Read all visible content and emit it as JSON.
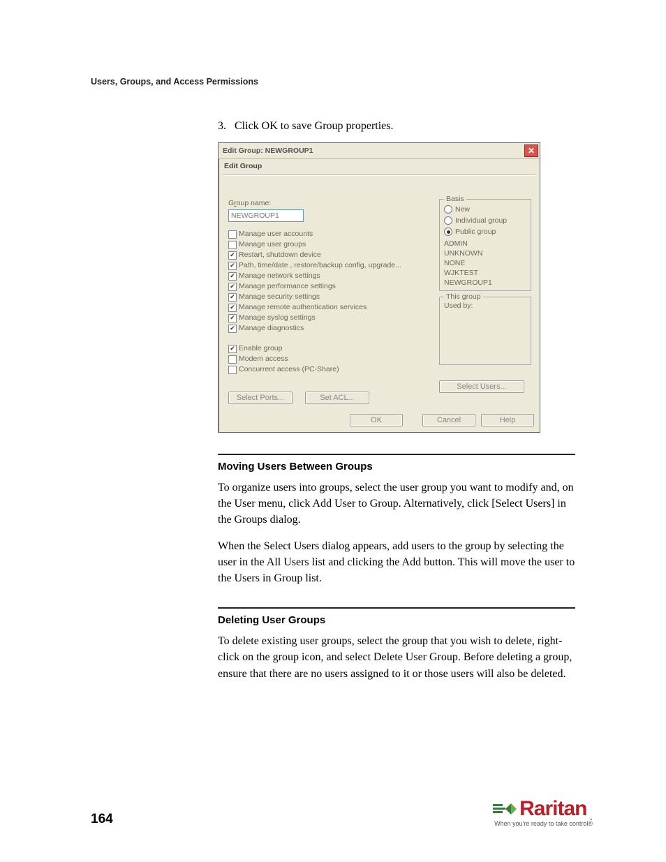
{
  "running_head": "Users, Groups, and Access Permissions",
  "step": {
    "num": "3.",
    "text": "Click OK to save Group properties."
  },
  "dialog": {
    "title": "Edit Group: NEWGROUP1",
    "close_glyph": "✕",
    "subtitle": "Edit Group",
    "group_name_label_pre": "G",
    "group_name_label_u": "r",
    "group_name_label_post": "oup name:",
    "group_name_value": "NEWGROUP1",
    "perms": [
      {
        "checked": false,
        "label": "Manage user accounts"
      },
      {
        "checked": false,
        "label": "Manage user groups"
      },
      {
        "checked": true,
        "label": "Restart, shutdown device"
      },
      {
        "checked": true,
        "label": "Path, time/date , restore/backup config, upgrade..."
      },
      {
        "checked": true,
        "label": "Manage network settings"
      },
      {
        "checked": true,
        "label": "Manage performance settings"
      },
      {
        "checked": true,
        "label": "Manage security settings"
      },
      {
        "checked": true,
        "label": "Manage remote authentication services"
      },
      {
        "checked": true,
        "label": "Manage syslog settings"
      },
      {
        "checked": true,
        "label": "Manage diagnostics"
      }
    ],
    "perms2": [
      {
        "checked": true,
        "label_pre": "",
        "label_u": "E",
        "label_post": "nable group"
      },
      {
        "checked": false,
        "label_pre": "Modem ",
        "label_u": "a",
        "label_post": "ccess"
      },
      {
        "checked": false,
        "label_pre": "Concurrent access (PC-",
        "label_u": "S",
        "label_post": "hare)"
      }
    ],
    "basis": {
      "legend": "Basis",
      "options": [
        {
          "sel": false,
          "pre": "",
          "u": "N",
          "post": "ew"
        },
        {
          "sel": false,
          "pre": "",
          "u": "I",
          "post": "ndividual group"
        },
        {
          "sel": true,
          "pre": "P",
          "u": "u",
          "post": "blic group"
        }
      ],
      "groups": [
        "ADMIN",
        "UNKNOWN",
        "NONE",
        "WJKTEST",
        "NEWGROUP1"
      ]
    },
    "this_group": {
      "legend": "This group",
      "used_by": "Used by:"
    },
    "btn_select_ports": "Select Ports...",
    "btn_set_acl": "Set ACL...",
    "btn_select_users": "Select Users...",
    "btn_ok": "OK",
    "btn_cancel": "Cancel",
    "btn_help": "Help"
  },
  "sections": {
    "moving_head": "Moving Users Between Groups",
    "moving_p1": "To organize users into groups, select the user group you want to modify and, on the User menu, click Add User to Group. Alternatively, click [Select Users] in the Groups dialog.",
    "moving_p2": "When the Select Users dialog appears, add users to the group by selecting the user in the All Users list and clicking the Add button. This will move the user to the Users in Group list.",
    "deleting_head": "Deleting User Groups",
    "deleting_p1": "To delete existing user groups, select the group that you wish to delete, right-click on the group icon, and select Delete User Group. Before deleting a group, ensure that there are no users assigned to it or those users will also be deleted."
  },
  "page_number": "164",
  "brand": {
    "name": "Raritan",
    "dot": ".",
    "tag": "When you're ready to take control®"
  }
}
